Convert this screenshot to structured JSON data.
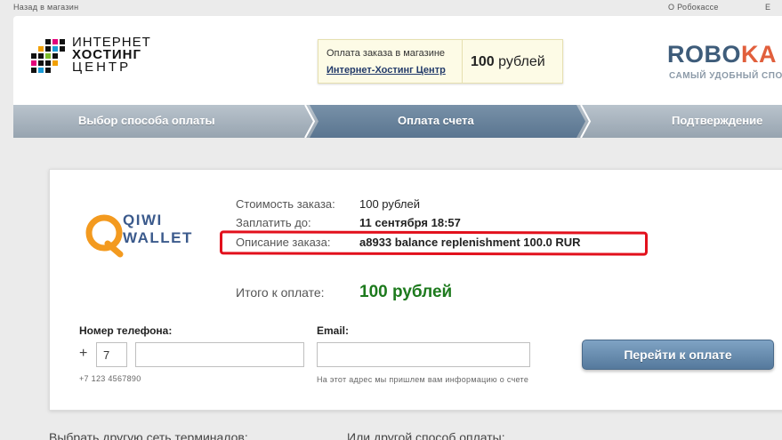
{
  "topbar": {
    "back_label": "Назад в магазин",
    "about_label": "О Робокассе",
    "more_label": "Е"
  },
  "merchant_logo": {
    "line1": "ИНТЕРНЕТ",
    "line2": "ХОСТИНГ",
    "line3": "ЦЕНТР"
  },
  "order_box": {
    "caption": "Оплата заказа в магазине",
    "shop_name": "Интернет-Хостинг Центр",
    "amount_number": "100",
    "amount_unit": "рублей"
  },
  "robokassa": {
    "logo_part1": "ROBO",
    "logo_part2": "KA",
    "tagline": "САМЫЙ УДОБНЫЙ СПО"
  },
  "steps": [
    {
      "label": "Выбор способа оплаты",
      "active": false
    },
    {
      "label": "Оплата счета",
      "active": true
    },
    {
      "label": "Подтверждение",
      "active": false
    }
  ],
  "payment_method": {
    "logo_line1": "QIWI",
    "logo_line2": "WALLET",
    "icon": "qiwi-wallet-icon"
  },
  "order_info": [
    {
      "label": "Стоимость заказа:",
      "value": "100 рублей"
    },
    {
      "label": "Заплатить до:",
      "value": "11 сентября 18:57"
    },
    {
      "label": "Описание заказа:",
      "value": "a8933 balance replenishment 100.0 RUR"
    }
  ],
  "total": {
    "label": "Итого к оплате:",
    "value": "100 рублей"
  },
  "form": {
    "phone_label": "Номер телефона:",
    "phone_plus": "+",
    "phone_code_value": "7",
    "phone_number_value": "",
    "phone_hint": "+7 123 4567890",
    "email_label": "Email:",
    "email_value": "",
    "email_hint": "На этот адрес мы пришлем вам информацию о счете",
    "submit_label": "Перейти к оплате"
  },
  "footer": {
    "other_terminals": "Выбрать другую сеть терминалов:",
    "other_method": "Или другой способ оплаты:"
  },
  "colors": {
    "accent_blue": "#3e5c7a",
    "accent_orange": "#e15f3c",
    "highlight_red": "#e2101c",
    "total_green": "#1d7a1d"
  }
}
